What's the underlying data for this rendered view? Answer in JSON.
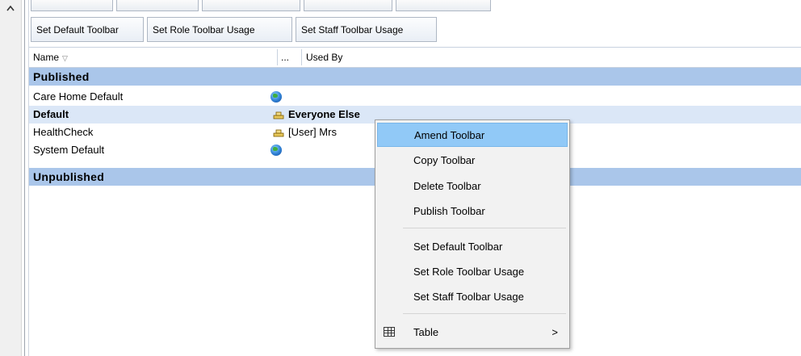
{
  "toolbar": {
    "set_default_label": "Set Default Toolbar",
    "set_role_usage_label": "Set Role Toolbar Usage",
    "set_staff_usage_label": "Set Staff Toolbar Usage"
  },
  "grid": {
    "columns": {
      "name": "Name",
      "ellipsis": "...",
      "used_by": "Used By"
    },
    "sort_icon": "sort-desc-icon",
    "groups": {
      "published": "Published",
      "unpublished": "Unpublished"
    },
    "rows": [
      {
        "name": "Care Home Default",
        "used_by": "",
        "icon": "globe-icon"
      },
      {
        "name": "Default",
        "used_by": "Everyone Else",
        "icon": "toolbar-icon",
        "selected": true
      },
      {
        "name": "HealthCheck",
        "used_by": "[User] Mrs",
        "icon": "toolbar-icon"
      },
      {
        "name": "System Default",
        "used_by": "",
        "icon": "globe-icon"
      }
    ]
  },
  "context_menu": {
    "items": [
      "Amend Toolbar",
      "Copy Toolbar",
      "Delete Toolbar",
      "Publish Toolbar",
      "Set Default Toolbar",
      "Set Role Toolbar Usage",
      "Set Staff Toolbar Usage",
      "Table"
    ],
    "submenu_arrow": ">"
  },
  "colors": {
    "group_header": "#aac6ea",
    "selected_row": "#dbe7f7",
    "menu_hover": "#91c9f7"
  }
}
